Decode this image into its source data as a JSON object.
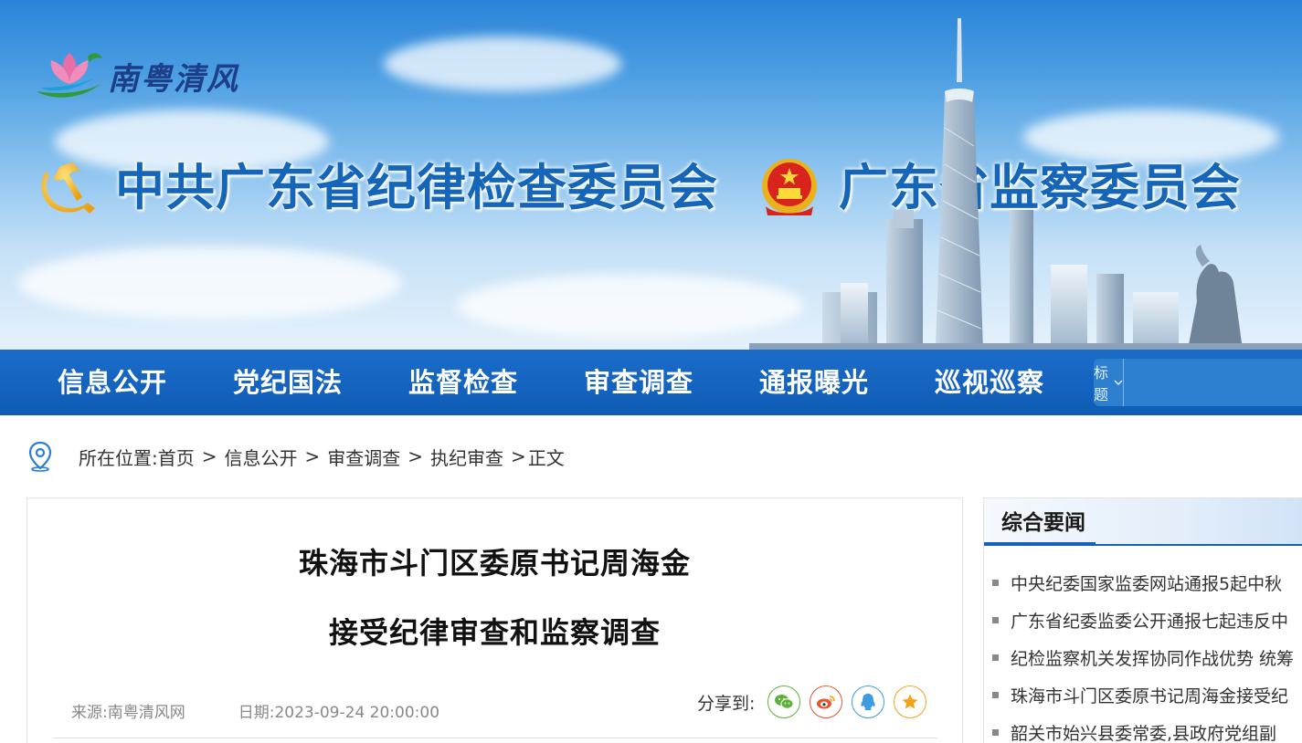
{
  "banner": {
    "logo_text": "南粤清风",
    "title_left": "中共广东省纪律检查委员会",
    "title_right": "广东省监察委员会"
  },
  "nav": {
    "items": [
      "信息公开",
      "党纪国法",
      "监督检查",
      "审查调查",
      "通报曝光",
      "巡视巡察"
    ],
    "search": {
      "select_label": "标题",
      "placeholder": ""
    }
  },
  "breadcrumb": {
    "label": "所在位置:",
    "items": [
      "首页",
      "信息公开",
      "审查调查",
      "执纪审查"
    ],
    "current": "正文",
    "separator": ">"
  },
  "article": {
    "title_line1": "珠海市斗门区委原书记周海金",
    "title_line2": "接受纪律审查和监察调查",
    "source": "来源:南粤清风网",
    "date": "日期:2023-09-24 20:00:00",
    "share_label": "分享到:",
    "share_icons": [
      "wechat-icon",
      "weibo-icon",
      "qq-icon",
      "favorite-star-icon"
    ]
  },
  "sidebar": {
    "heading": "综合要闻",
    "news": [
      "中央纪委国家监委网站通报5起中秋",
      "广东省纪委监委公开通报七起违反中",
      "纪检监察机关发挥协同作战优势 统筹",
      "珠海市斗门区委原书记周海金接受纪",
      "韶关市始兴县委常委,县政府党组副"
    ]
  },
  "colors": {
    "nav_blue": "#0f5cb6",
    "title_blue": "#1565b8",
    "wechat": "#5fb13a",
    "weibo": "#e2572e",
    "qq": "#3d9be0",
    "star": "#f2a31d"
  }
}
